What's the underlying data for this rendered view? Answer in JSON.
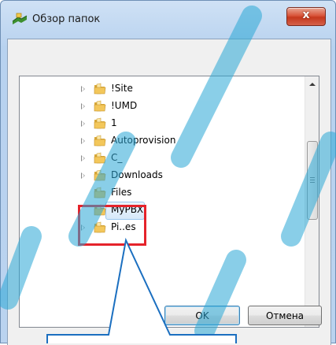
{
  "window": {
    "title": "Обзор папок",
    "close_label": "x"
  },
  "tree": {
    "items": [
      {
        "label": "!Site",
        "has_children": true
      },
      {
        "label": "!UMD",
        "has_children": true
      },
      {
        "label": "1",
        "has_children": true
      },
      {
        "label": "Autoprovision",
        "has_children": true
      },
      {
        "label": "C_",
        "has_children": true
      },
      {
        "label": "Downloads",
        "has_children": true
      },
      {
        "label": "Files",
        "has_children": false
      },
      {
        "label": "MyPBX",
        "has_children": false,
        "selected": true
      },
      {
        "label": "Pi..es",
        "has_children": true
      }
    ]
  },
  "buttons": {
    "ok_label": "OK",
    "cancel_label": "Отмена"
  },
  "colors": {
    "highlight_box": "#e5232b",
    "callout_stroke": "#1b6fc0",
    "watermark": "#2aa7d6"
  },
  "icons": {
    "title": "folder-browse-icon",
    "tree_item": "folder-icon",
    "expander": "expand-arrow-icon"
  }
}
